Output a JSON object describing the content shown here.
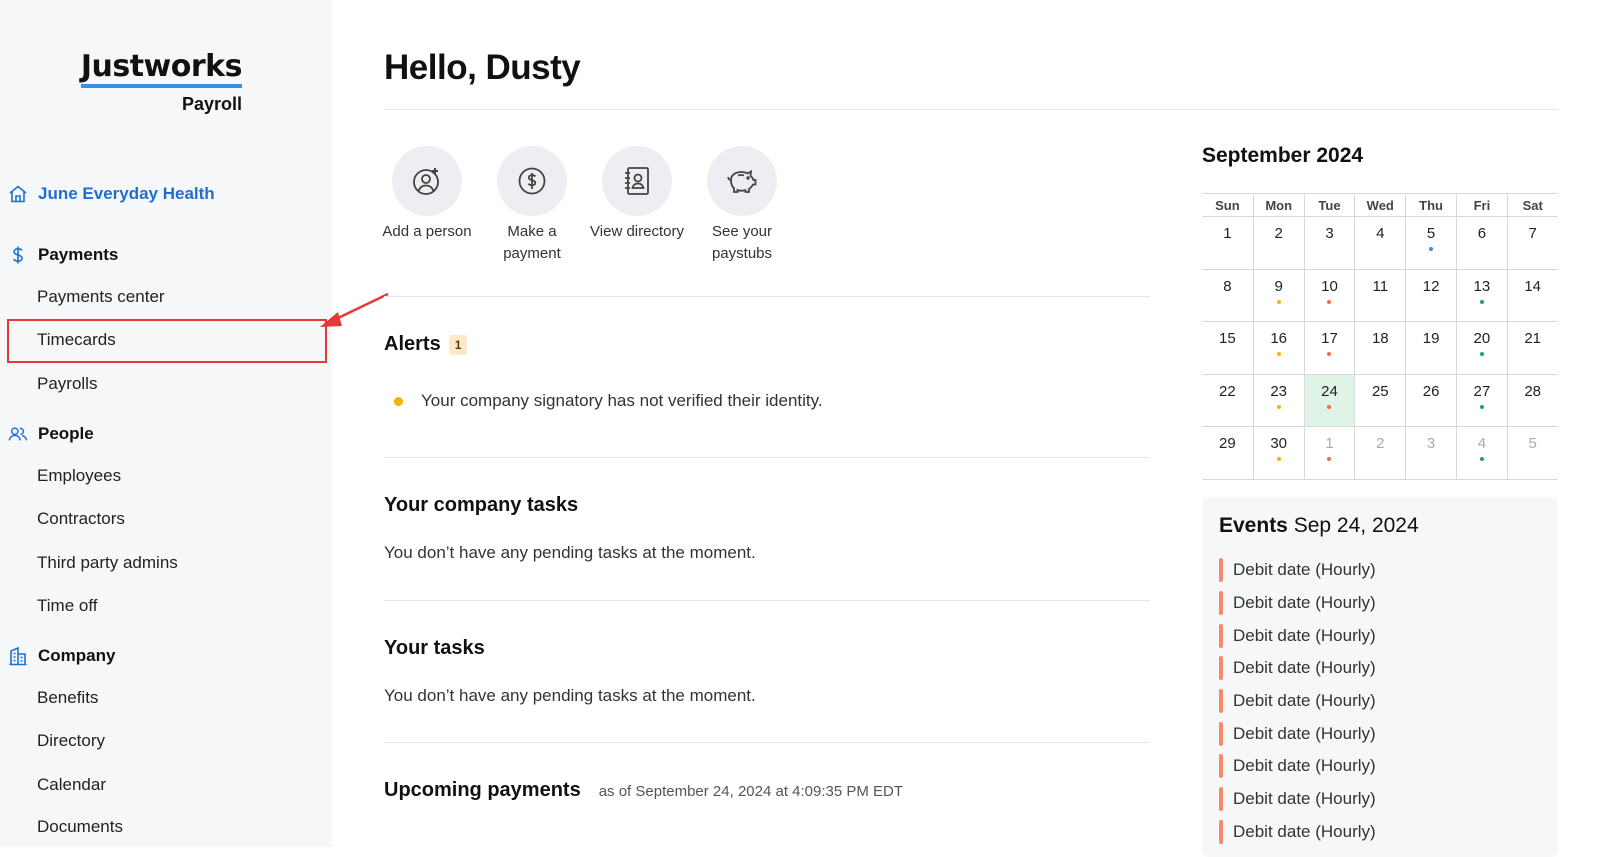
{
  "brand": {
    "name": "Justworks",
    "product": "Payroll"
  },
  "sidebar": {
    "company": "June Everyday Health",
    "sections": [
      {
        "title": "Payments",
        "items": [
          "Payments center",
          "Timecards",
          "Payrolls"
        ]
      },
      {
        "title": "People",
        "items": [
          "Employees",
          "Contractors",
          "Third party admins",
          "Time off"
        ]
      },
      {
        "title": "Company",
        "items": [
          "Benefits",
          "Directory",
          "Calendar",
          "Documents"
        ]
      }
    ]
  },
  "main": {
    "greeting": "Hello, Dusty",
    "actions": [
      {
        "label": "Add a person",
        "icon": "add-person-icon"
      },
      {
        "label": "Make a payment",
        "icon": "dollar-icon"
      },
      {
        "label": "View directory",
        "icon": "directory-icon"
      },
      {
        "label": "See your paystubs",
        "icon": "piggy-bank-icon"
      }
    ],
    "alerts": {
      "title": "Alerts",
      "count": "1",
      "items": [
        "Your company signatory has not verified their identity."
      ]
    },
    "company_tasks": {
      "title": "Your company tasks",
      "text": "You don’t have any pending tasks at the moment."
    },
    "your_tasks": {
      "title": "Your tasks",
      "text": "You don’t have any pending tasks at the moment."
    },
    "upcoming": {
      "title": "Upcoming payments",
      "as_of": "as of September 24, 2024 at 4:09:35 PM EDT"
    }
  },
  "calendar": {
    "title": "September 2024",
    "weekdays": [
      "Sun",
      "Mon",
      "Tue",
      "Wed",
      "Thu",
      "Fri",
      "Sat"
    ],
    "weeks": [
      [
        {
          "d": "1"
        },
        {
          "d": "2"
        },
        {
          "d": "3"
        },
        {
          "d": "4"
        },
        {
          "d": "5",
          "dot": "blue"
        },
        {
          "d": "6"
        },
        {
          "d": "7"
        }
      ],
      [
        {
          "d": "8"
        },
        {
          "d": "9",
          "dot": "yellow"
        },
        {
          "d": "10",
          "dot": "red"
        },
        {
          "d": "11"
        },
        {
          "d": "12"
        },
        {
          "d": "13",
          "dot": "green"
        },
        {
          "d": "14"
        }
      ],
      [
        {
          "d": "15"
        },
        {
          "d": "16",
          "dot": "yellow"
        },
        {
          "d": "17",
          "dot": "red"
        },
        {
          "d": "18"
        },
        {
          "d": "19"
        },
        {
          "d": "20",
          "dot": "green"
        },
        {
          "d": "21"
        }
      ],
      [
        {
          "d": "22"
        },
        {
          "d": "23",
          "dot": "yellow"
        },
        {
          "d": "24",
          "dot": "red",
          "today": true
        },
        {
          "d": "25"
        },
        {
          "d": "26"
        },
        {
          "d": "27",
          "dot": "green"
        },
        {
          "d": "28"
        }
      ],
      [
        {
          "d": "29"
        },
        {
          "d": "30",
          "dot": "yellow"
        },
        {
          "d": "1",
          "dot": "red",
          "muted": true
        },
        {
          "d": "2",
          "muted": true
        },
        {
          "d": "3",
          "muted": true
        },
        {
          "d": "4",
          "dot": "green",
          "muted": true
        },
        {
          "d": "5",
          "muted": true
        }
      ]
    ],
    "dot_colors": {
      "blue": "#3b8fe0",
      "yellow": "#f5b400",
      "red": "#f26b4f",
      "green": "#1f9d6b"
    }
  },
  "events": {
    "label": "Events",
    "date": "Sep 24, 2024",
    "bar_color": "#f58a68",
    "items": [
      "Debit date (Hourly)",
      "Debit date (Hourly)",
      "Debit date (Hourly)",
      "Debit date (Hourly)",
      "Debit date (Hourly)",
      "Debit date (Hourly)",
      "Debit date (Hourly)",
      "Debit date (Hourly)",
      "Debit date (Hourly)"
    ]
  }
}
